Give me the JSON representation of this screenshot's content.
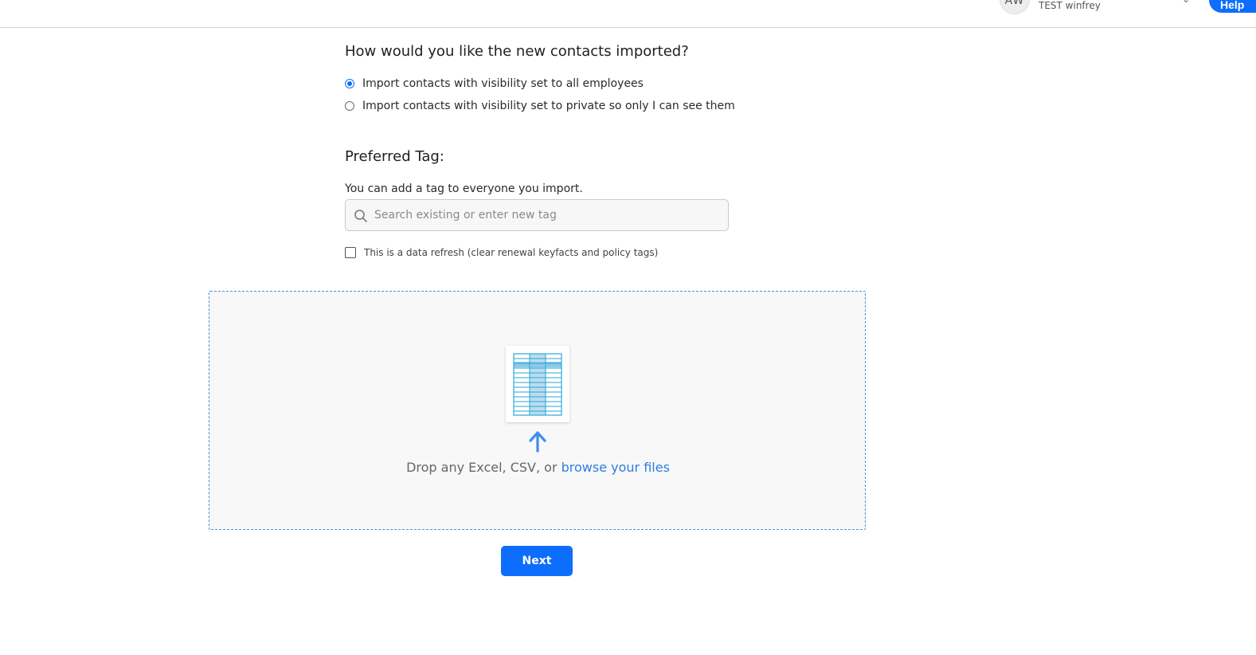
{
  "header": {
    "avatar_initials": "AW",
    "user_name": "TEST winfrey",
    "help_label": "Help"
  },
  "visibility": {
    "question": "How would you like the new contacts imported?",
    "options": [
      {
        "label": "Import contacts with visibility set to all employees",
        "selected": true
      },
      {
        "label": "Import contacts with visibility set to private so only I can see them",
        "selected": false
      }
    ]
  },
  "tag": {
    "title": "Preferred Tag:",
    "help_text": "You can add a tag to everyone you import.",
    "placeholder": "Search existing or enter new tag",
    "value": ""
  },
  "refresh": {
    "label": "This is a data refresh (clear renewal keyfacts and policy tags)",
    "checked": false
  },
  "dropzone": {
    "text": "Drop any Excel, CSV, or ",
    "link": "browse your files",
    "icon": "spreadsheet-icon",
    "arrow_icon": "upload-arrow-icon",
    "border_color": "#4a8fe0"
  },
  "actions": {
    "next_label": "Next"
  },
  "colors": {
    "accent": "#0d6efd",
    "link": "#2f7de1",
    "sheet": "#2aa6d9"
  }
}
